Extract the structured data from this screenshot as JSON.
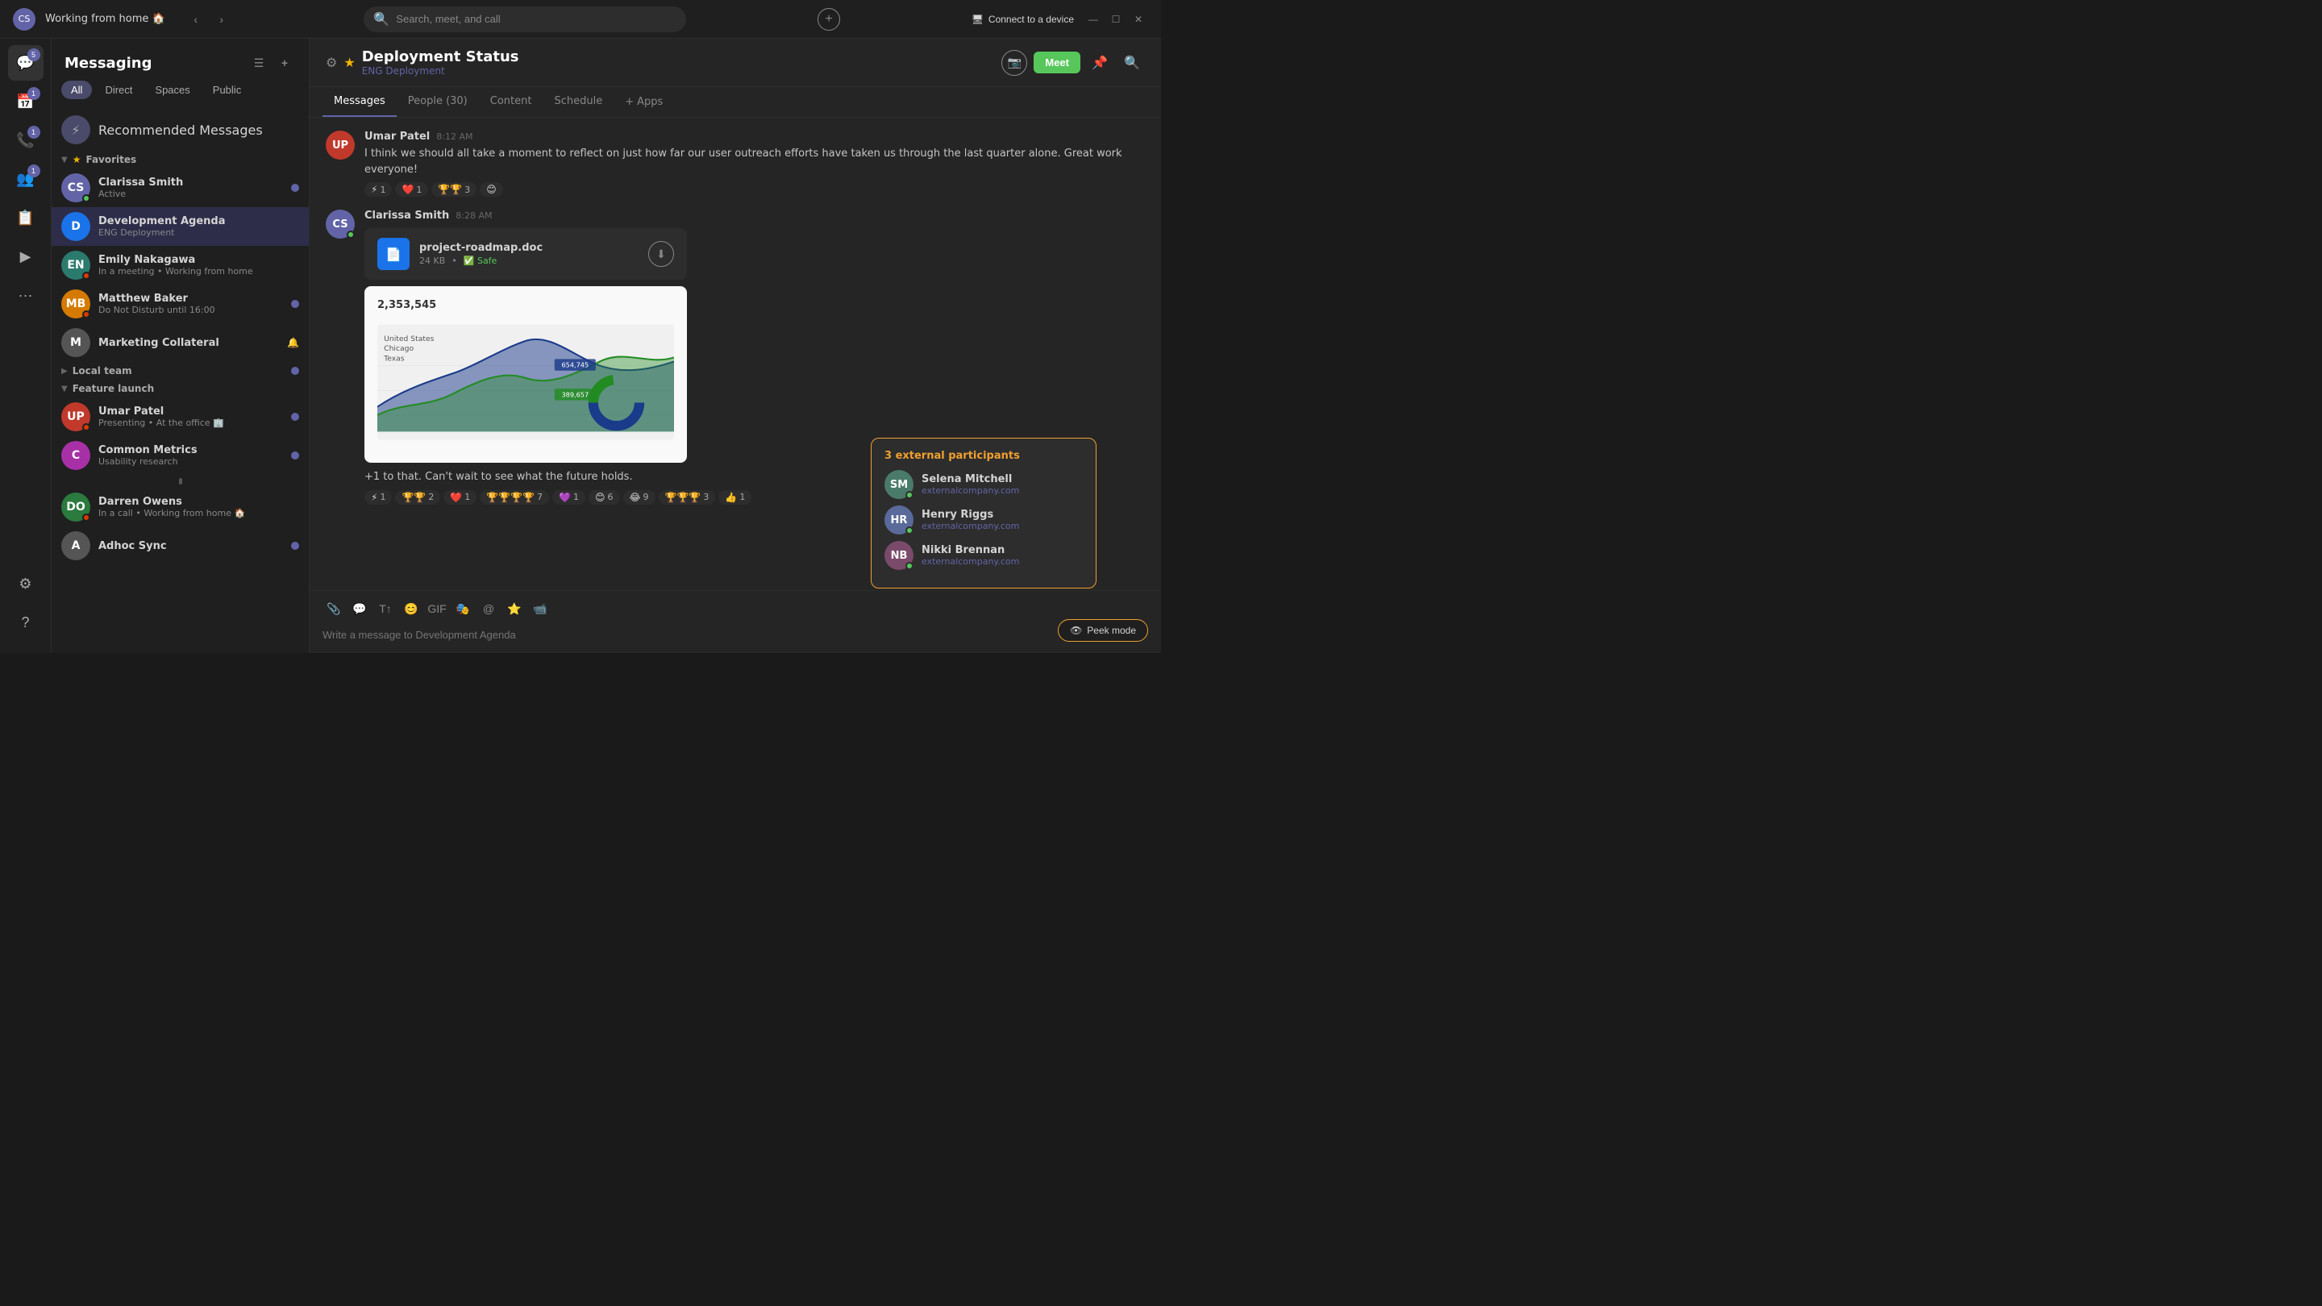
{
  "titlebar": {
    "avatar_initials": "CS",
    "status": "Working from home 🏠",
    "search_placeholder": "Search, meet, and call",
    "connect_label": "Connect to a device"
  },
  "icon_sidebar": {
    "items": [
      {
        "name": "chat",
        "icon": "💬",
        "badge": "5"
      },
      {
        "name": "calendar",
        "icon": "📅",
        "badge": "1"
      },
      {
        "name": "calls",
        "icon": "📞",
        "badge": "1"
      },
      {
        "name": "people",
        "icon": "👥",
        "badge": "1"
      },
      {
        "name": "contacts",
        "icon": "📋",
        "badge": null
      },
      {
        "name": "activity",
        "icon": "▶",
        "badge": null
      },
      {
        "name": "more",
        "icon": "•••",
        "badge": null
      }
    ],
    "bottom": [
      {
        "name": "settings",
        "icon": "⚙"
      },
      {
        "name": "help",
        "icon": "?"
      }
    ]
  },
  "messaging": {
    "title": "Messaging",
    "filter_tabs": [
      "All",
      "Direct",
      "Spaces",
      "Public"
    ],
    "active_filter": "All",
    "recommended_label": "Recommended Messages",
    "sections": {
      "favorites": {
        "label": "Favorites",
        "items": [
          {
            "name": "Clarissa Smith",
            "status": "Active",
            "status_type": "active",
            "initials": "CS",
            "avatar_color": "av-purple",
            "unread": true
          },
          {
            "name": "Development Agenda",
            "status": "ENG Deployment",
            "initials": "D",
            "avatar_color": "av-blue",
            "active": true
          }
        ]
      },
      "ungrouped": [
        {
          "name": "Emily Nakagawa",
          "status": "In a meeting • Working from home",
          "status_type": "meeting",
          "initials": "EN",
          "avatar_color": "av-teal"
        },
        {
          "name": "Matthew Baker",
          "status": "Do Not Disturb until 16:00",
          "status_type": "dnd",
          "initials": "MB",
          "avatar_color": "av-orange",
          "unread": true
        },
        {
          "name": "Marketing Collateral",
          "status": "",
          "initials": "M",
          "avatar_color": "av-gray",
          "muted": true
        }
      ],
      "local_team": {
        "label": "Local team",
        "unread": true
      },
      "feature_launch": {
        "label": "Feature launch",
        "items": [
          {
            "name": "Umar Patel",
            "status": "Presenting • At the office 🏢",
            "status_type": "presenting",
            "initials": "UP",
            "avatar_color": "av-red",
            "unread": true
          },
          {
            "name": "Common Metrics",
            "status": "Usability research",
            "initials": "C",
            "avatar_color": "av-pink",
            "unread": true
          }
        ]
      },
      "bottom_items": [
        {
          "name": "Darren Owens",
          "status": "In a call • Working from home 🏠",
          "status_type": "in-call",
          "initials": "DO",
          "avatar_color": "av-green"
        },
        {
          "name": "Adhoc Sync",
          "status": "",
          "initials": "A",
          "avatar_color": "av-gray",
          "unread": true
        }
      ]
    }
  },
  "channel": {
    "title": "Deployment Status",
    "subtitle": "ENG Deployment",
    "tabs": [
      {
        "label": "Messages",
        "active": true
      },
      {
        "label": "People (30)",
        "active": false
      },
      {
        "label": "Content",
        "active": false
      },
      {
        "label": "Schedule",
        "active": false
      },
      {
        "label": "Apps",
        "active": false
      }
    ],
    "add_tab_label": "+ Apps"
  },
  "messages": [
    {
      "author": "Umar Patel",
      "time": "8:12 AM",
      "text": "I think we should all take a moment to reflect on just how far our user outreach efforts have taken us through the last quarter alone. Great work everyone!",
      "initials": "UP",
      "avatar_color": "av-red",
      "reactions": [
        {
          "emoji": "⚡",
          "count": "1"
        },
        {
          "emoji": "❤️",
          "count": "1"
        },
        {
          "emoji": "🏆🏆",
          "count": "3"
        },
        {
          "emoji": "😊",
          "count": ""
        }
      ]
    },
    {
      "author": "Clarissa Smith",
      "time": "8:28 AM",
      "text": "+1 to that. Can't wait to see what the future holds.",
      "initials": "CS",
      "avatar_color": "av-purple",
      "has_file": true,
      "file_name": "project-roadmap.doc",
      "file_size": "24 KB",
      "file_safe": "Safe",
      "has_chart": true,
      "chart_value": "2,353,545",
      "reactions2": [
        {
          "emoji": "⚡",
          "count": "1"
        },
        {
          "emoji": "🏆🏆",
          "count": "2"
        },
        {
          "emoji": "❤️",
          "count": "1"
        },
        {
          "emoji": "🏆🏆🏆🏆",
          "count": "7"
        },
        {
          "emoji": "💜",
          "count": "1"
        },
        {
          "emoji": "😊",
          "count": "6"
        },
        {
          "emoji": "😂",
          "count": "9"
        },
        {
          "emoji": "🏆🏆🏆",
          "count": "3"
        },
        {
          "emoji": "👍",
          "count": "1"
        }
      ]
    }
  ],
  "message_input": {
    "placeholder": "Write a message to Development Agenda"
  },
  "external_participants": {
    "title": "3 external participants",
    "participants": [
      {
        "name": "Selena Mitchell",
        "email": "externalcompany.com",
        "initials": "SM"
      },
      {
        "name": "Henry Riggs",
        "email": "externalcompany.com",
        "initials": "HR"
      },
      {
        "name": "Nikki Brennan",
        "email": "externalcompany.com",
        "initials": "NB"
      }
    ]
  },
  "peek_mode": {
    "label": "Peek mode"
  }
}
